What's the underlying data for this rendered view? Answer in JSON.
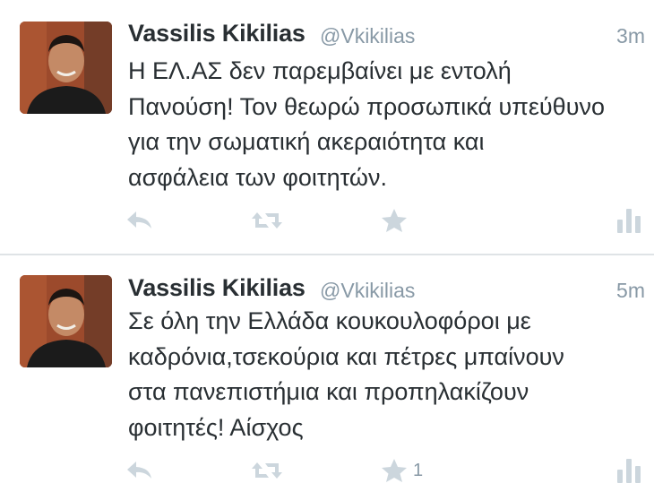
{
  "tweets": [
    {
      "author_name": "Vassilis Kikilias",
      "handle": "@Vkikilias",
      "time": "3m",
      "text": "Η ΕΛ.ΑΣ δεν παρεμβαίνει με εντολή\nΠανούση! Τον θεωρώ προσωπικά υπεύθυνο\nγια την σωματική ακεραιότητα και\nασφάλεια των φοιτητών.",
      "favorite_count": ""
    },
    {
      "author_name": "Vassilis Kikilias",
      "handle": "@Vkikilias",
      "time": "5m",
      "text": "Σε όλη την Ελλάδα κουκουλοφόροι με\nκαδρόνια,τσεκούρια και πέτρες μπαίνουν\nστα πανεπιστήμια και προπηλακίζουν\nφοιτητές! Αίσχος",
      "favorite_count": "1"
    }
  ],
  "icons": {
    "reply": "reply-icon",
    "retweet": "retweet-icon",
    "favorite": "star-icon",
    "stats": "stats-icon",
    "avatar": "avatar"
  },
  "colors": {
    "name": "#292f33",
    "meta": "#8899a6",
    "icon": "#ccd6dd",
    "divider": "#dfe3e6"
  }
}
